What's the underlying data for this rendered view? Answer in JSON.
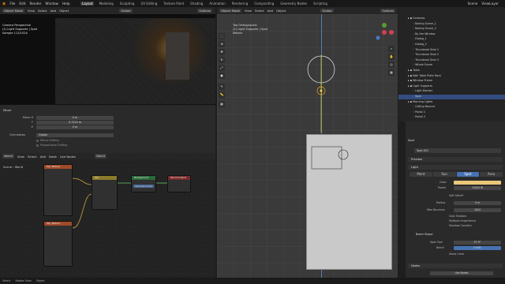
{
  "menu": [
    "File",
    "Edit",
    "Render",
    "Window",
    "Help"
  ],
  "workspaces": [
    "Layout",
    "Modeling",
    "Sculpting",
    "UV Editing",
    "Texture Paint",
    "Shading",
    "Animation",
    "Rendering",
    "Compositing",
    "Geometry Nodes",
    "Scripting"
  ],
  "active_workspace": "Layout",
  "scene": "Scene",
  "view_layer": "ViewLayer",
  "left_header": {
    "mode": "Object Mode",
    "items": [
      "View",
      "Select",
      "Add",
      "Object"
    ],
    "orient": "Global",
    "options": "Options"
  },
  "render_info": {
    "line1": "Camera Perspective",
    "line2": "(1) Light Supports | Spot",
    "line3": "Sample 112/1024"
  },
  "move": {
    "title": "Move",
    "labels": [
      "Move X",
      "Y",
      "Z"
    ],
    "values": [
      "0 m",
      "0.7225 m",
      "0 m"
    ],
    "orientation_label": "Orientation",
    "orientation": "Global",
    "mirror": "Mirror Editing",
    "proportional": "Proportional Editing"
  },
  "node_header": {
    "type": "World",
    "items": [
      "View",
      "Select",
      "Add",
      "Node"
    ],
    "use_nodes": "Use Nodes",
    "world": "World"
  },
  "node_breadcrumb": {
    "scene": "Scene",
    "world": "World"
  },
  "nodes": {
    "tex1": "Sky Texture",
    "tex2": "Sky Texture",
    "mix": "Mix",
    "bg": "Background",
    "out": "World Output",
    "bg_strength_label": "Strength",
    "bg_strength": "0.050"
  },
  "viewport_header": {
    "mode": "Object Mode",
    "items": [
      "View",
      "Select",
      "Add",
      "Object"
    ],
    "orient": "Global",
    "options": "Options"
  },
  "viewport_info": {
    "line1": "Top Orthographic",
    "line2": "(1) Light Supports | Spot",
    "line3": "Meters"
  },
  "outliner": [
    {
      "name": "Cameras",
      "indent": 1
    },
    {
      "name": "Baking Scene_1",
      "indent": 2
    },
    {
      "name": "Baking Scene_2",
      "indent": 2
    },
    {
      "name": "By the Window",
      "indent": 2
    },
    {
      "name": "Dialog_1",
      "indent": 2
    },
    {
      "name": "Dialog_2",
      "indent": 2
    },
    {
      "name": "Thumbnail Shot 1",
      "indent": 2
    },
    {
      "name": "Thumbnail Shot 2",
      "indent": 2
    },
    {
      "name": "Thumbnail Shot 3",
      "indent": 2
    },
    {
      "name": "Whole Scene",
      "indent": 2
    },
    {
      "name": "Table",
      "indent": 1
    },
    {
      "name": "Wall Table Plate Rack",
      "indent": 1
    },
    {
      "name": "Window Frame",
      "indent": 1
    },
    {
      "name": "Light Supports",
      "indent": 1
    },
    {
      "name": "Light Blocker",
      "indent": 2
    },
    {
      "name": "Spot",
      "indent": 2,
      "selected": true
    },
    {
      "name": "Morning Lights",
      "indent": 1
    },
    {
      "name": "Ceiling Bounce",
      "indent": 2
    },
    {
      "name": "Portal 1",
      "indent": 2
    },
    {
      "name": "Portal 2",
      "indent": 2
    }
  ],
  "props": {
    "breadcrumb": "Spot",
    "datablock": "Spot.001",
    "preview": "Preview",
    "light": "Light",
    "types": [
      "Point",
      "Sun",
      "Spot",
      "Area"
    ],
    "active_type": "Spot",
    "color_label": "Color",
    "power_label": "Power",
    "power": "15000 W",
    "soft_falloff": "Soft Falloff",
    "radius_label": "Radius",
    "radius": "0 m",
    "max_bounces_label": "Max Bounces",
    "max_bounces": "1024",
    "cast_shadow": "Cast Shadow",
    "multiple_importance": "Multiple Importance",
    "shadow_caustics": "Shadow Caustics",
    "beam_shape": "Beam Shape",
    "spot_size_label": "Spot Size",
    "spot_size": "57.9°",
    "blend_label": "Blend",
    "blend": "0.000",
    "show_cone": "Show Cone",
    "nodes": "Nodes",
    "use_nodes": "Use Nodes"
  },
  "status": {
    "select": "Select",
    "rotate": "Rotate View",
    "object": "Object"
  }
}
